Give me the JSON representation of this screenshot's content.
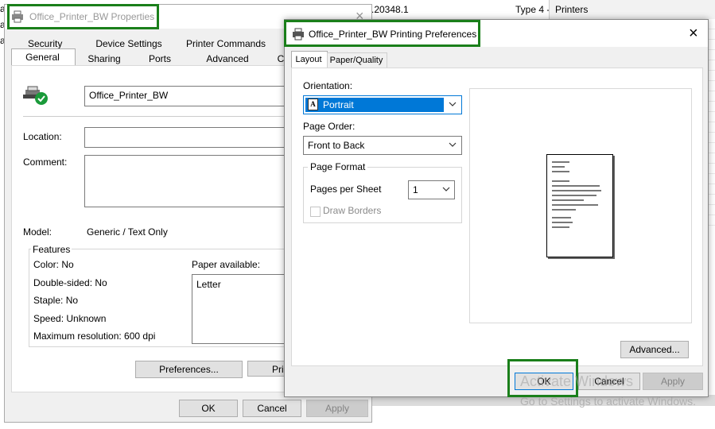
{
  "background_window": {
    "version_text": ".20348.1",
    "type_text": "Type 4 -",
    "printers_header": "Printers",
    "left_edge": [
      "a",
      "a",
      "a"
    ]
  },
  "properties_dialog": {
    "title": "Office_Printer_BW Properties",
    "close_icon": "×",
    "tabs_row1": [
      "Security",
      "Device Settings",
      "Printer Commands"
    ],
    "tabs_row2": [
      "General",
      "Sharing",
      "Ports",
      "Advanced",
      "C"
    ],
    "printer_name": "Office_Printer_BW",
    "location_label": "Location:",
    "location_value": "",
    "comment_label": "Comment:",
    "comment_value": "",
    "model_label": "Model:",
    "model_value": "Generic / Text Only",
    "features_title": "Features",
    "color": "Color: No",
    "double_sided": "Double-sided: No",
    "staple": "Staple: No",
    "speed": "Speed: Unknown",
    "max_resolution": "Maximum resolution: 600 dpi",
    "paper_available_label": "Paper available:",
    "paper_available_value": "Letter",
    "preferences_button": "Preferences...",
    "print_test_button": "Prin",
    "ok_button": "OK",
    "cancel_button": "Cancel",
    "apply_button": "Apply"
  },
  "preferences_dialog": {
    "title": "Office_Printer_BW Printing Preferences",
    "close_icon": "×",
    "tabs": [
      "Layout",
      "Paper/Quality"
    ],
    "orientation_label": "Orientation:",
    "orientation_value": "Portrait",
    "page_order_label": "Page Order:",
    "page_order_value": "Front to Back",
    "page_format_title": "Page Format",
    "pages_per_sheet_label": "Pages per Sheet",
    "pages_per_sheet_value": "1",
    "draw_borders_label": "Draw Borders",
    "advanced_button": "Advanced...",
    "ok_button": "OK",
    "cancel_button": "Cancel",
    "apply_button": "Apply"
  },
  "watermark": {
    "line1": "Activate Windows",
    "line2": "Go to Settings to activate Windows."
  },
  "colors": {
    "highlight_green": "#1a7f1a",
    "selection_blue": "#0078d7",
    "dialog_bg": "#f0f0f0"
  }
}
